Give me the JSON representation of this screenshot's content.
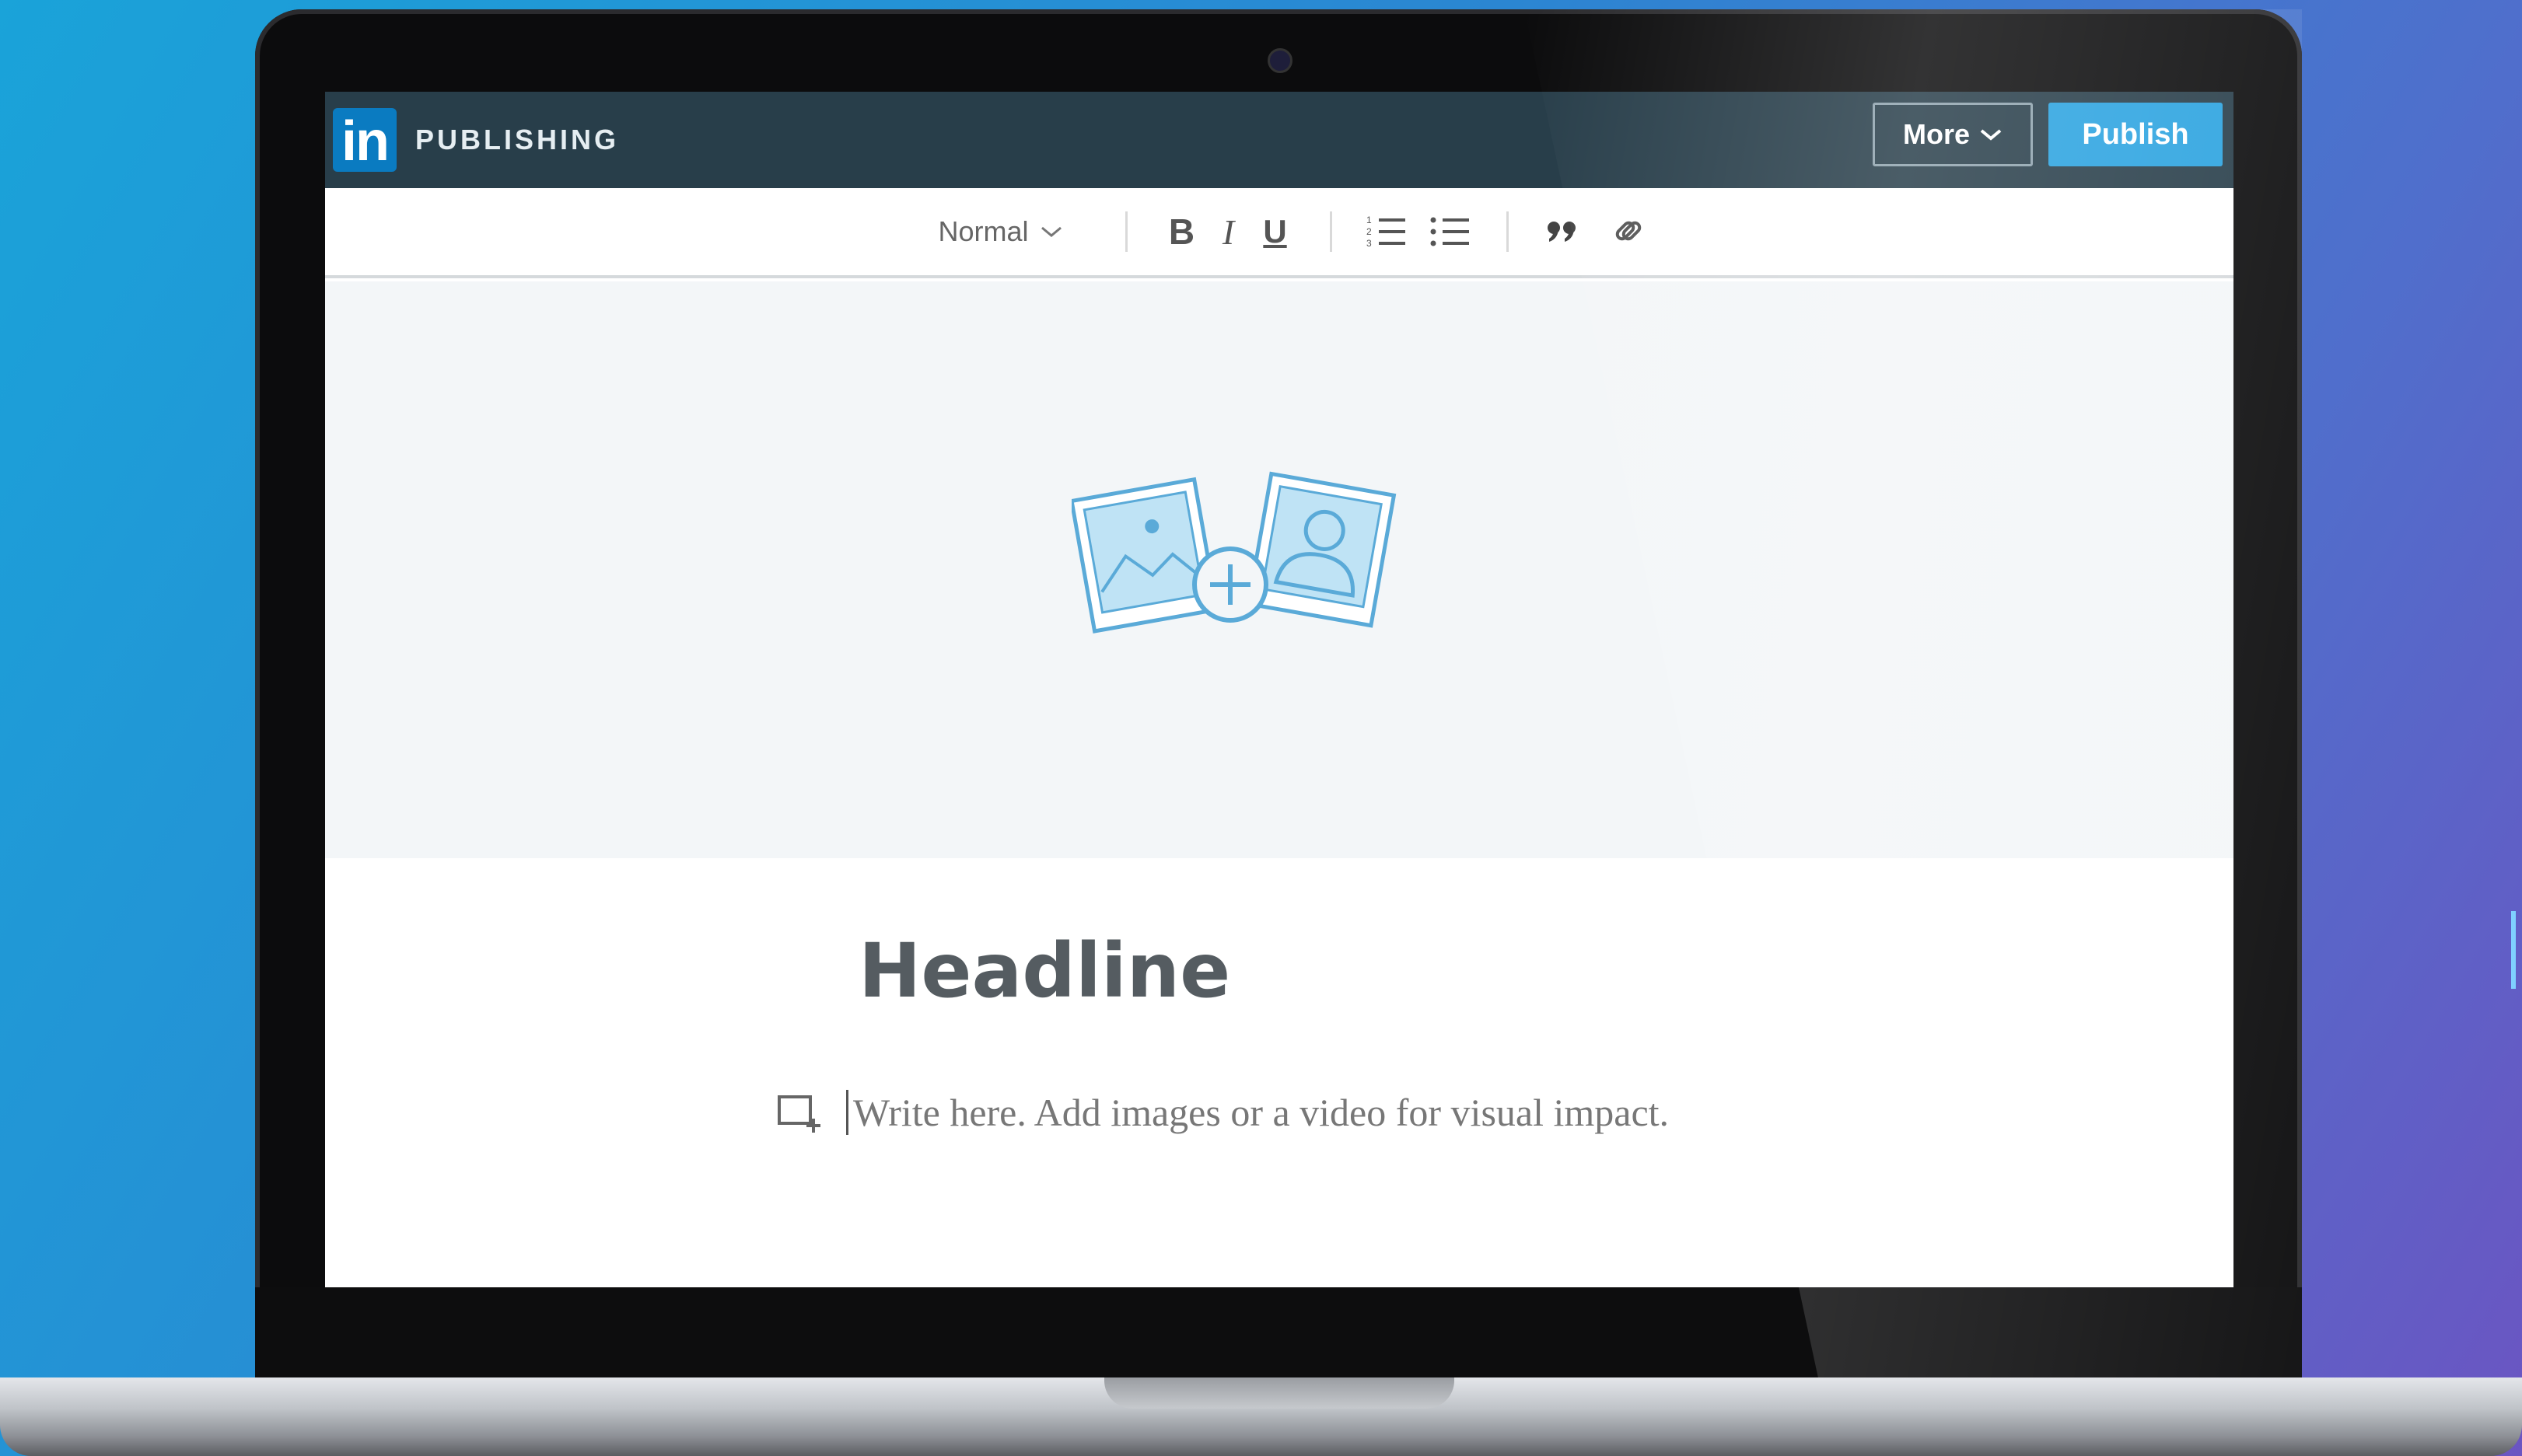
{
  "app": {
    "logo_text": "in",
    "brand": "PUBLISHING"
  },
  "topbar": {
    "more_label": "More",
    "publish_label": "Publish"
  },
  "toolbar": {
    "style_select": "Normal",
    "buttons": [
      "bold",
      "italic",
      "underline",
      "numbered-list",
      "bulleted-list",
      "quote",
      "link"
    ],
    "bold_label": "B",
    "italic_label": "I",
    "underline_label": "U"
  },
  "editor": {
    "cover_icon": "add-image-icon",
    "headline_placeholder": "Headline",
    "body_placeholder": "Write here. Add images or a video for visual impact."
  },
  "colors": {
    "topbar_bg": "#283e4a",
    "accent": "#2ba3e0",
    "logo_bg": "#0a7bc1"
  }
}
